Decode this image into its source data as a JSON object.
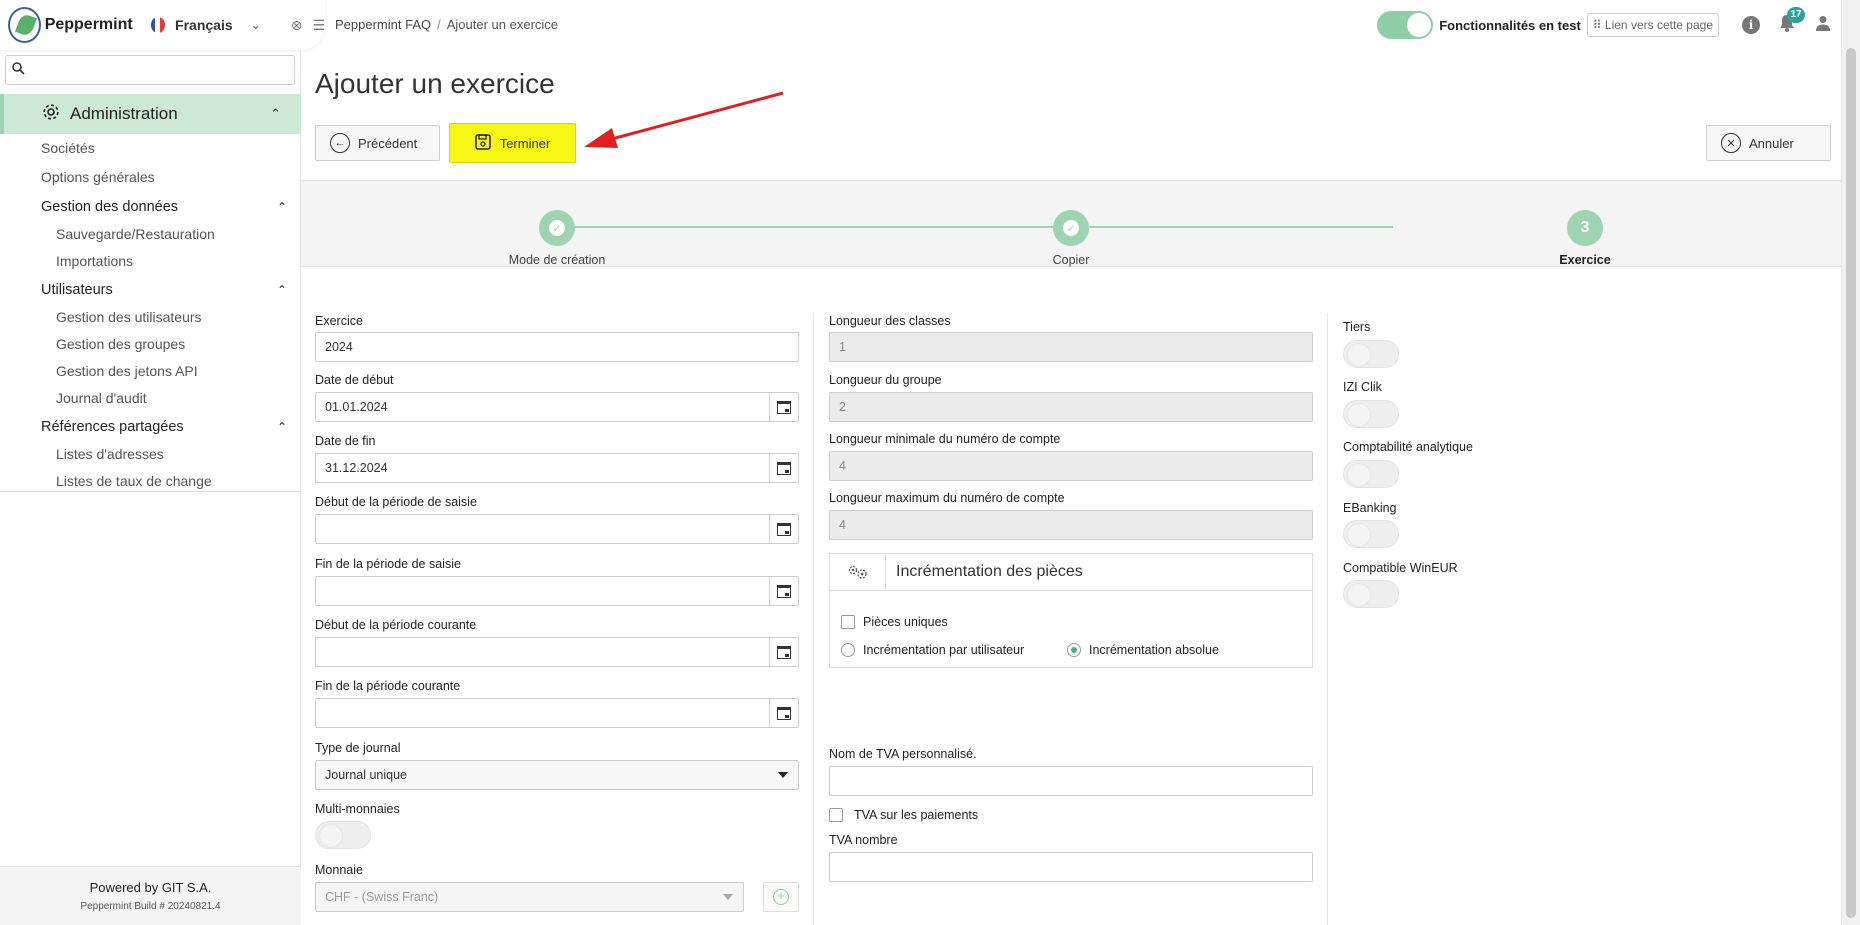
{
  "app": {
    "brand": "Peppermint",
    "language": "Français",
    "powered_by": "Powered by GIT S.A.",
    "build": "Peppermint Build # 20240821.4"
  },
  "sidebar": {
    "search_placeholder": "",
    "section": "Administration",
    "items": [
      {
        "type": "item",
        "label": "Sociétés"
      },
      {
        "type": "item",
        "label": "Options générales"
      },
      {
        "type": "group",
        "label": "Gestion des données"
      },
      {
        "type": "sub",
        "label": "Sauvegarde/Restauration"
      },
      {
        "type": "sub",
        "label": "Importations"
      },
      {
        "type": "group",
        "label": "Utilisateurs"
      },
      {
        "type": "sub",
        "label": "Gestion des utilisateurs"
      },
      {
        "type": "sub",
        "label": "Gestion des groupes"
      },
      {
        "type": "sub",
        "label": "Gestion des jetons API"
      },
      {
        "type": "sub",
        "label": "Journal d'audit"
      },
      {
        "type": "group",
        "label": "Références partagées"
      },
      {
        "type": "sub",
        "label": "Listes d'adresses"
      },
      {
        "type": "sub",
        "label": "Listes de taux de change"
      }
    ]
  },
  "topbar": {
    "breadcrumb_root": "Peppermint FAQ",
    "breadcrumb_sep": "/",
    "breadcrumb_current": "Ajouter un exercice",
    "features_label": "Fonctionnalités en test",
    "link_label": "⠿ Lien vers cette page",
    "notifications_count": "17"
  },
  "page": {
    "title": "Ajouter un exercice",
    "prev_label": "Précédent",
    "finish_label": "Terminer",
    "cancel_label": "Annuler"
  },
  "steps": [
    {
      "label": "Mode de création",
      "state": "done"
    },
    {
      "label": "Copier",
      "state": "done"
    },
    {
      "label": "Exercice",
      "state": "active",
      "number": "3"
    }
  ],
  "form": {
    "exercice_label": "Exercice",
    "exercice_value": "2024",
    "date_debut_label": "Date de début",
    "date_debut_value": "01.01.2024",
    "date_fin_label": "Date de fin",
    "date_fin_value": "31.12.2024",
    "debut_saisie_label": "Début de la période de saisie",
    "fin_saisie_label": "Fin de la période de saisie",
    "debut_courante_label": "Début de la période courante",
    "fin_courante_label": "Fin de la période courante",
    "type_journal_label": "Type de journal",
    "type_journal_value": "Journal unique",
    "multi_monnaies_label": "Multi-monnaies",
    "monnaie_label": "Monnaie",
    "monnaie_value": "CHF - (Swiss Franc)",
    "long_classes_label": "Longueur des classes",
    "long_classes_value": "1",
    "long_groupe_label": "Longueur du groupe",
    "long_groupe_value": "2",
    "long_min_label": "Longueur minimale du numéro de compte",
    "long_min_value": "4",
    "long_max_label": "Longueur maximum du numéro de compte",
    "long_max_value": "4",
    "increment_title": "Incrémentation des pièces",
    "pieces_uniques": "Pièces uniques",
    "inc_user": "Incrémentation par utilisateur",
    "inc_abs": "Incrémentation absolue",
    "nom_tva_label": "Nom de TVA personnalisé.",
    "tva_paiements": "TVA sur les paiements",
    "tva_nombre_label": "TVA nombre",
    "tiers_label": "Tiers",
    "izi_label": "IZI Clik",
    "analytique_label": "Comptabilité analytique",
    "ebanking_label": "EBanking",
    "wineur_label": "Compatible WinEUR"
  },
  "colors": {
    "accent": "#9ed4b1",
    "sidebar_active": "#cde9d6",
    "highlight": "#f7f716",
    "arrow": "#e02020"
  }
}
